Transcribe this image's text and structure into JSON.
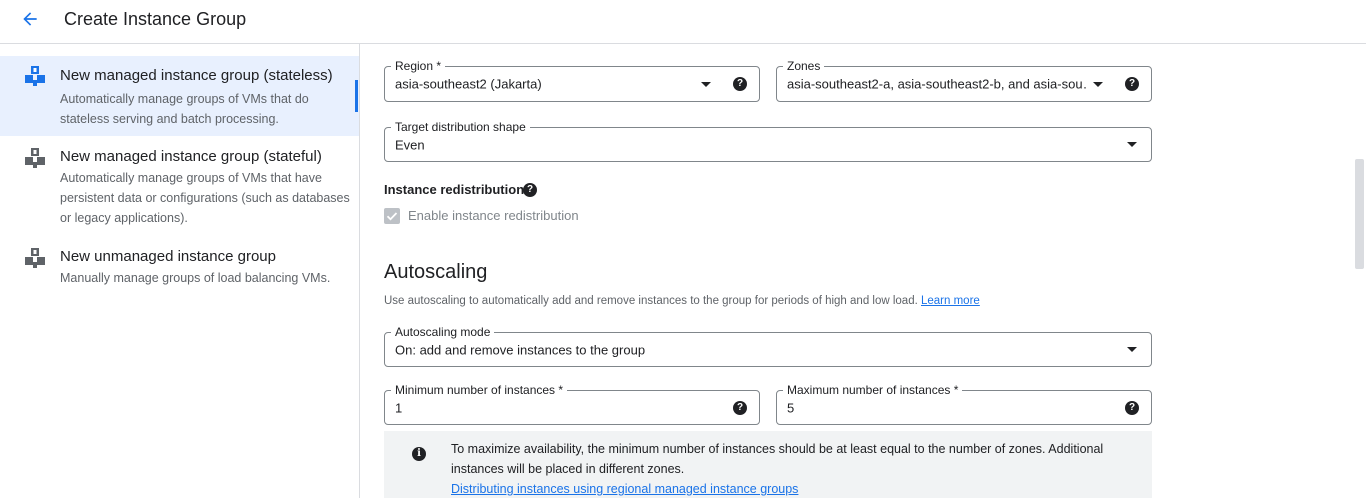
{
  "header": {
    "title": "Create Instance Group",
    "back_icon": "arrow-back-icon"
  },
  "options": [
    {
      "title": "New managed instance group (stateless)",
      "desc": "Automatically manage groups of VMs that do stateless serving and batch processing.",
      "selected": true
    },
    {
      "title": "New managed instance group (stateful)",
      "desc": "Automatically manage groups of VMs that have persistent data or configurations (such as databases or legacy applications).",
      "selected": false
    },
    {
      "title": "New unmanaged instance group",
      "desc": "Manually manage groups of load balancing VMs.",
      "selected": false
    }
  ],
  "form": {
    "region": {
      "label": "Region *",
      "value": "asia-southeast2 (Jakarta)"
    },
    "zones": {
      "label": "Zones",
      "value": "asia-southeast2-a, asia-southeast2-b, and asia-sou…"
    },
    "distribution": {
      "label": "Target distribution shape",
      "value": "Even"
    },
    "redistribution": {
      "title": "Instance redistribution",
      "checkbox_label": "Enable instance redistribution",
      "checked": true,
      "disabled": true
    }
  },
  "autoscaling": {
    "title": "Autoscaling",
    "description": "Use autoscaling to automatically add and remove instances to the group for periods of high and low load.",
    "learn_more": "Learn more",
    "mode": {
      "label": "Autoscaling mode",
      "value": "On: add and remove instances to the group"
    },
    "min": {
      "label": "Minimum number of instances *",
      "value": "1"
    },
    "max": {
      "label": "Maximum number of instances *",
      "value": "5"
    },
    "info": {
      "text": "To maximize availability, the minimum number of instances should be at least equal to the number of zones. Additional instances will be placed in different zones.",
      "link": "Distributing instances using regional managed instance groups"
    }
  },
  "colors": {
    "accent": "#1a73e8",
    "selected_bg": "#e8f0fe",
    "info_bg": "#f1f3f4"
  }
}
